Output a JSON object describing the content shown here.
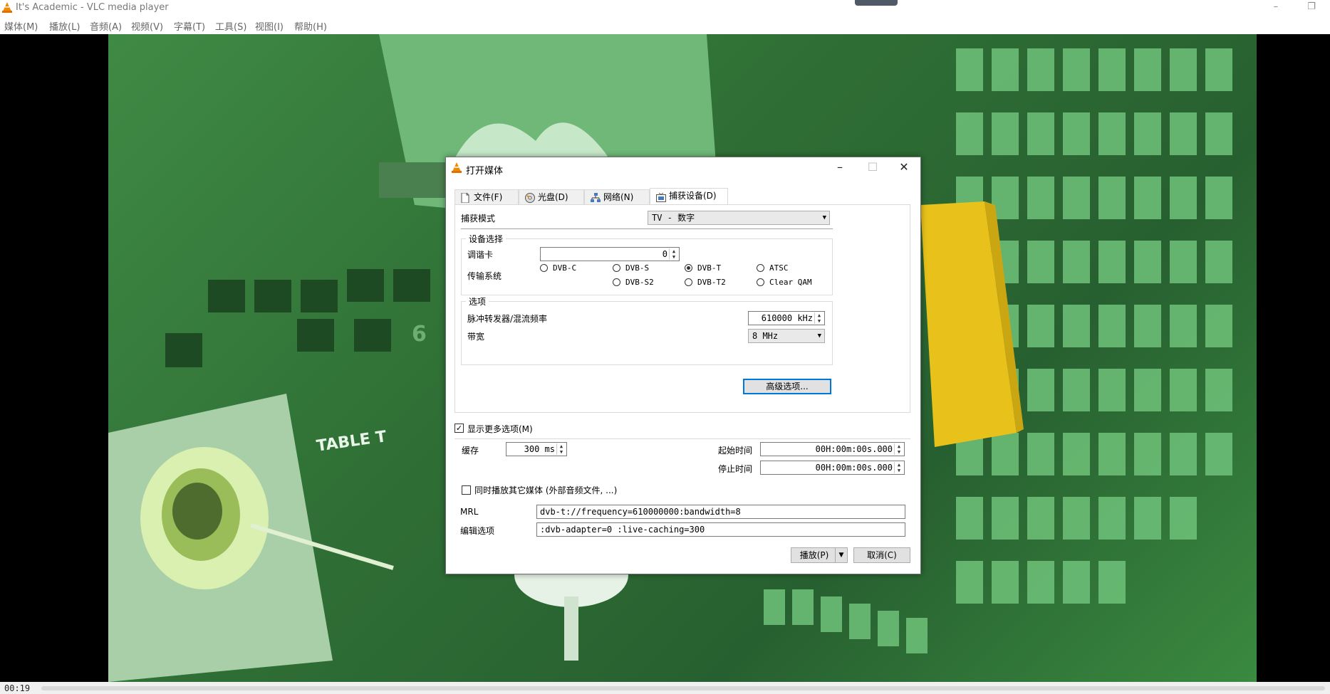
{
  "window": {
    "title": "It's Academic - VLC media player",
    "restore_icon": "restore-icon"
  },
  "menu": [
    "媒体(M)",
    "播放(L)",
    "音频(A)",
    "视频(V)",
    "字幕(T)",
    "工具(S)",
    "视图(I)",
    "帮助(H)"
  ],
  "status": {
    "time": "00:19",
    "progress": 0.0
  },
  "video": {
    "overlay_text": "TABLE T",
    "digit": "6"
  },
  "dialog": {
    "title": "打开媒体",
    "tabs": [
      {
        "label": "文件(F)",
        "icon": "file-icon"
      },
      {
        "label": "光盘(D)",
        "icon": "disc-icon"
      },
      {
        "label": "网络(N)",
        "icon": "network-icon"
      },
      {
        "label": "捕获设备(D)",
        "icon": "capture-icon"
      }
    ],
    "capture_mode_label": "捕获模式",
    "capture_mode_value": "TV - 数字",
    "device_group": "设备选择",
    "tuner_label": "调谐卡",
    "tuner_value": "0",
    "transport_label": "传输系统",
    "radios": {
      "dvbc": "DVB-C",
      "dvbs": "DVB-S",
      "dvbt": "DVB-T",
      "atsc": "ATSC",
      "dvbs2": "DVB-S2",
      "dvbt2": "DVB-T2",
      "clearqam": "Clear QAM"
    },
    "selected_transport": "DVB-T",
    "options_group": "选项",
    "freq_label": "脉冲转发器/混流频率",
    "freq_value": "610000 kHz",
    "bandwidth_label": "带宽",
    "bandwidth_value": "8 MHz",
    "advanced_button": "高级选项...",
    "show_more_label": "显示更多选项(M)",
    "show_more_checked": true,
    "cache_label": "缓存",
    "cache_value": "300 ms",
    "start_time_label": "起始时间",
    "start_time_value": "00H:00m:00s.000",
    "stop_time_label": "停止时间",
    "stop_time_value": "00H:00m:00s.000",
    "sync_label": "同时播放其它媒体 (外部音频文件, ...)",
    "sync_checked": false,
    "mrl_label": "MRL",
    "mrl_value": "dvb-t://frequency=610000000:bandwidth=8",
    "edit_label": "编辑选项",
    "edit_value": " :dvb-adapter=0 :live-caching=300",
    "play_button": "播放(P)",
    "cancel_button": "取消(C)"
  }
}
